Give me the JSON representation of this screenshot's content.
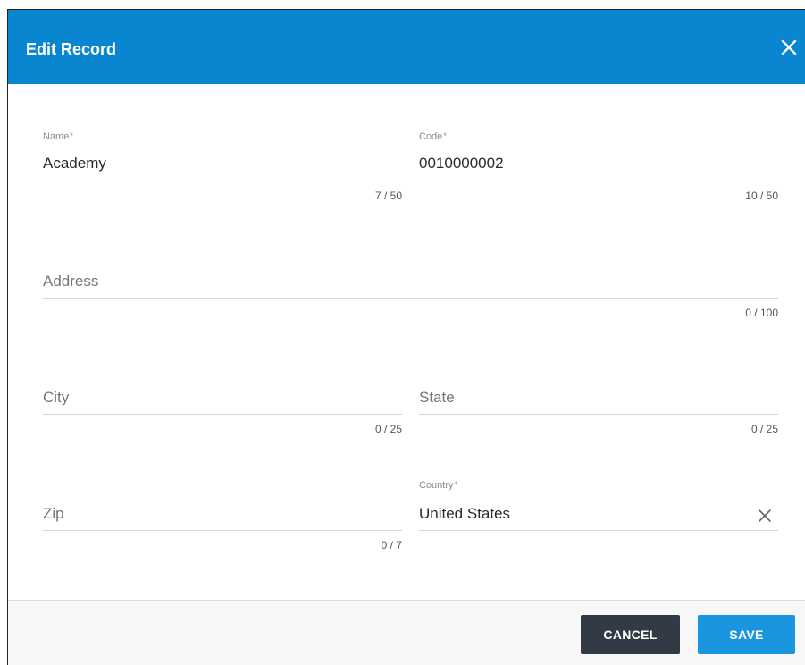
{
  "dialog": {
    "title": "Edit Record"
  },
  "fields": {
    "name": {
      "label": "Name",
      "required": "*",
      "value": "Academy",
      "counter": "7 / 50"
    },
    "code": {
      "label": "Code",
      "required": "*",
      "value": "0010000002",
      "counter": "10 / 50"
    },
    "address": {
      "placeholder": "Address",
      "counter": "0 / 100"
    },
    "city": {
      "placeholder": "City",
      "counter": "0 / 25"
    },
    "state": {
      "placeholder": "State",
      "counter": "0 / 25"
    },
    "zip": {
      "placeholder": "Zip",
      "counter": "0 / 7"
    },
    "country": {
      "label": "Country",
      "required": "*",
      "value": "United States"
    }
  },
  "footer": {
    "cancel_label": "CANCEL",
    "save_label": "SAVE"
  },
  "colors": {
    "header": "#0a86d1",
    "save": "#1a95e0",
    "cancel": "#323a45"
  },
  "icons": {
    "close": "close-icon",
    "clear": "clear-icon"
  }
}
